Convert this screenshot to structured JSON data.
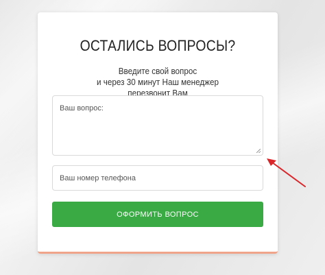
{
  "form": {
    "title": "ОСТАЛИСЬ ВОПРОСЫ?",
    "subtitle_lines": [
      "Введите свой вопрос",
      "и через 30 минут Наш менеджер",
      "перезвонит Вам"
    ],
    "question_placeholder": "Ваш вопрос:",
    "phone_placeholder": "Ваш номер телефона",
    "submit_label": "ОФОРМИТЬ ВОПРОС"
  },
  "colors": {
    "submit_bg": "#3aaa45",
    "arrow": "#d9262a",
    "card_bottom_accent": "#f0a58a"
  },
  "icons": {
    "resize": "resize-handle-icon",
    "annotation": "red-arrow-icon"
  }
}
